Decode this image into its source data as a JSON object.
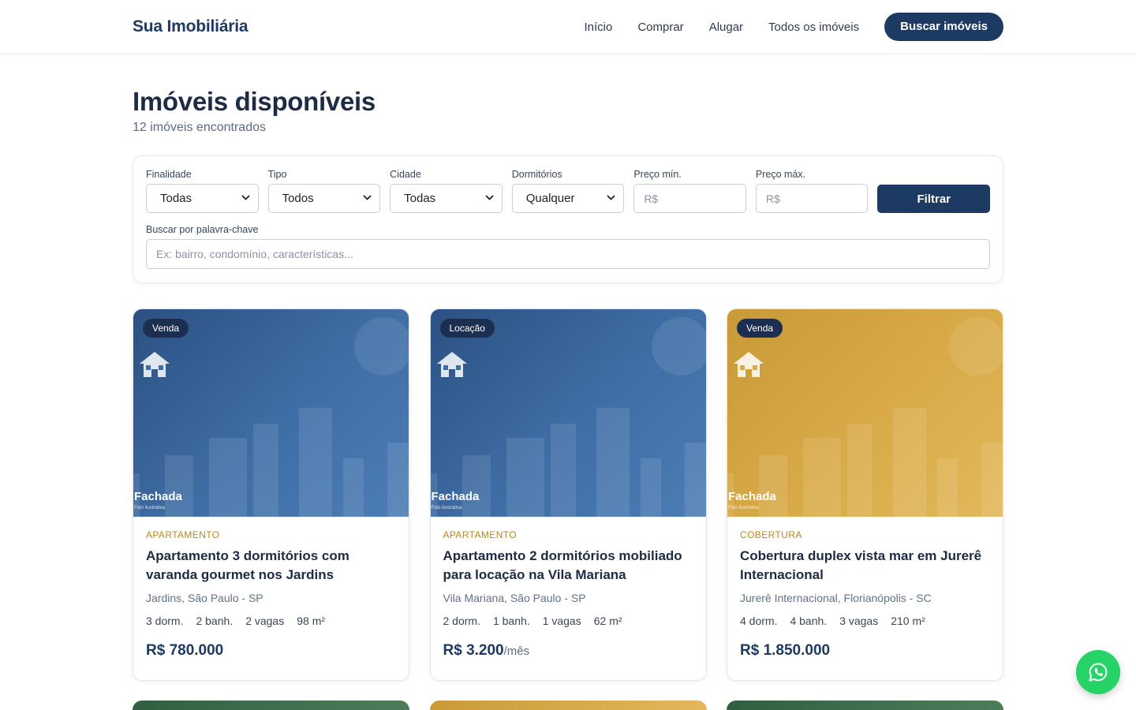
{
  "header": {
    "brand": "Sua Imobiliária",
    "nav": [
      "Início",
      "Comprar",
      "Alugar",
      "Todos os imóveis"
    ],
    "cta": "Buscar imóveis"
  },
  "page": {
    "title": "Imóveis disponíveis",
    "subtitle": "12 imóveis encontrados"
  },
  "filters": {
    "finalidade": {
      "label": "Finalidade",
      "value": "Todas"
    },
    "tipo": {
      "label": "Tipo",
      "value": "Todos"
    },
    "cidade": {
      "label": "Cidade",
      "value": "Todas"
    },
    "dormitorios": {
      "label": "Dormitórios",
      "value": "Qualquer"
    },
    "preco_min": {
      "label": "Preço mín.",
      "placeholder": "R$"
    },
    "preco_max": {
      "label": "Preço máx.",
      "placeholder": "R$"
    },
    "button": "Filtrar",
    "keyword": {
      "label": "Buscar por palavra-chave",
      "placeholder": "Ex: bairro, condomínio, características..."
    }
  },
  "cards": [
    {
      "badge": "Venda",
      "caption": "Fachada",
      "note": "Foto ilustrativa",
      "type": "APARTAMENTO",
      "title": "Apartamento 3 dormitórios com varanda gourmet nos Jardins",
      "location": "Jardins, São Paulo - SP",
      "dorm": "3 dorm.",
      "banh": "2 banh.",
      "vagas": "2 vagas",
      "area": "98 m²",
      "price": "R$ 780.000",
      "suffix": "",
      "color": "#3f6ea6"
    },
    {
      "badge": "Locação",
      "caption": "Fachada",
      "note": "Foto ilustrativa",
      "type": "APARTAMENTO",
      "title": "Apartamento 2 dormitórios mobiliado para locação na Vila Mariana",
      "location": "Vila Mariana, São Paulo - SP",
      "dorm": "2 dorm.",
      "banh": "1 banh.",
      "vagas": "1 vagas",
      "area": "62 m²",
      "price": "R$ 3.200",
      "suffix": "/mês",
      "color": "#3f6ea6"
    },
    {
      "badge": "Venda",
      "caption": "Fachada",
      "note": "Foto ilustrativa",
      "type": "COBERTURA",
      "title": "Cobertura duplex vista mar em Jurerê Internacional",
      "location": "Jurerê Internacional, Florianópolis - SC",
      "dorm": "4 dorm.",
      "banh": "4 banh.",
      "vagas": "3 vagas",
      "area": "210 m²",
      "price": "R$ 1.850.000",
      "suffix": "",
      "color": "#d8ab48"
    }
  ],
  "colors": {
    "primary": "#1d3a63",
    "accent": "#b8891e",
    "whatsapp": "#25d366"
  }
}
